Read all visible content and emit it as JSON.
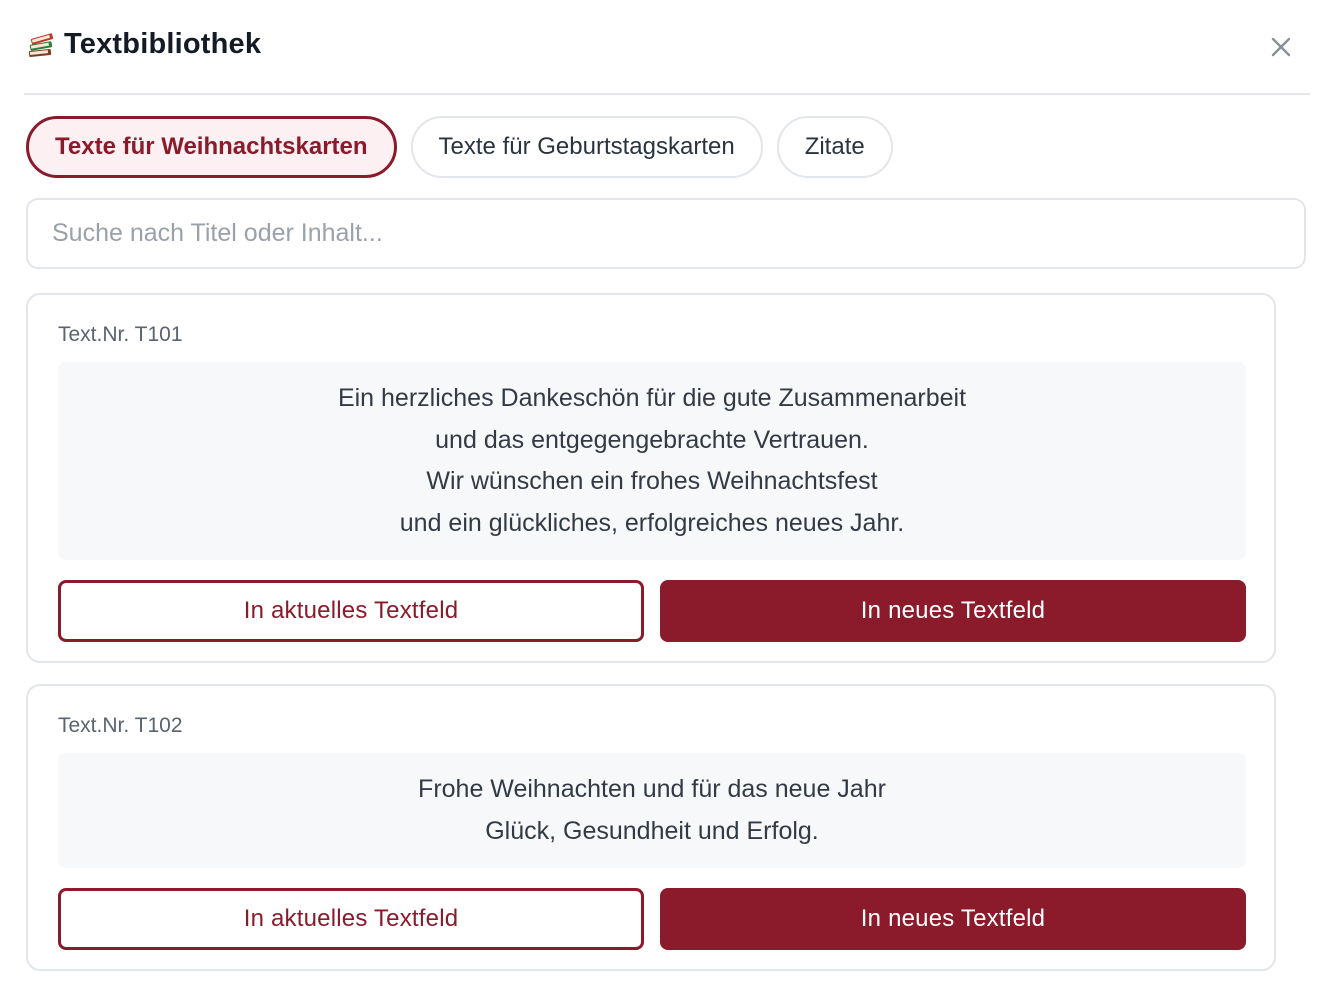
{
  "header": {
    "title": "Textbibliothek",
    "icon": "books-icon",
    "close_icon": "close-icon"
  },
  "tabs": [
    {
      "label": "Texte für Weihnachtskarten",
      "active": true
    },
    {
      "label": "Texte für Geburtstagskarten",
      "active": false
    },
    {
      "label": "Zitate",
      "active": false
    }
  ],
  "search": {
    "placeholder": "Suche nach Titel oder Inhalt...",
    "value": ""
  },
  "cards": [
    {
      "id_label": "Text.Nr. T101",
      "lines": [
        "Ein herzliches Dankeschön für die gute Zusammenarbeit",
        "und das entgegengebrachte Vertrauen.",
        "Wir wünschen ein frohes Weihnachtsfest",
        "und ein glückliches, erfolgreiches neues Jahr."
      ],
      "btn_current": "In aktuelles Textfeld",
      "btn_new": "In neues Textfeld"
    },
    {
      "id_label": "Text.Nr. T102",
      "lines": [
        "Frohe Weihnachten und für das neue Jahr",
        "Glück, Gesundheit und Erfolg."
      ],
      "btn_current": "In aktuelles Textfeld",
      "btn_new": "In neues Textfeld"
    }
  ],
  "colors": {
    "accent": "#8b1a2b",
    "accent_bg": "#fdf0f2",
    "border": "#e2e5ea",
    "text_box_bg": "#f7f8fa"
  }
}
